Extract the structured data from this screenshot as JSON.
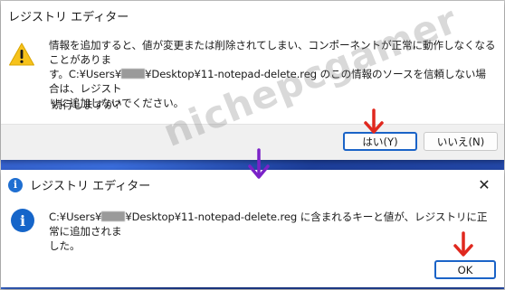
{
  "dialog1": {
    "title": "レジストリ エディター",
    "message_line1": "情報を追加すると、値が変更または削除されてしまい、コンポーネントが正常に動作しなくなることがありま",
    "message_line2a": "す。C:¥Users¥",
    "message_line2b": "¥Desktop¥11-notepad-delete.reg のこの情報のソースを信頼しない場合は、レジスト",
    "message_line3": "リに追加しないでください。",
    "prompt": "続行しますか?",
    "yes_label": "はい(Y)",
    "no_label": "いいえ(N)",
    "icon": "warning-icon"
  },
  "dialog2": {
    "title": "レジストリ エディター",
    "message_line1a": "C:¥Users¥",
    "message_line1b": "¥Desktop¥11-notepad-delete.reg に含まれるキーと値が、レジストリに正常に追加されま",
    "message_line2": "した。",
    "ok_label": "OK",
    "close_label": "✕",
    "icon": "info-icon"
  },
  "watermark": "nichepcgamer",
  "colors": {
    "accent": "#1a63c7",
    "arrow_red": "#e0281e",
    "arrow_purple": "#7b22c8"
  }
}
